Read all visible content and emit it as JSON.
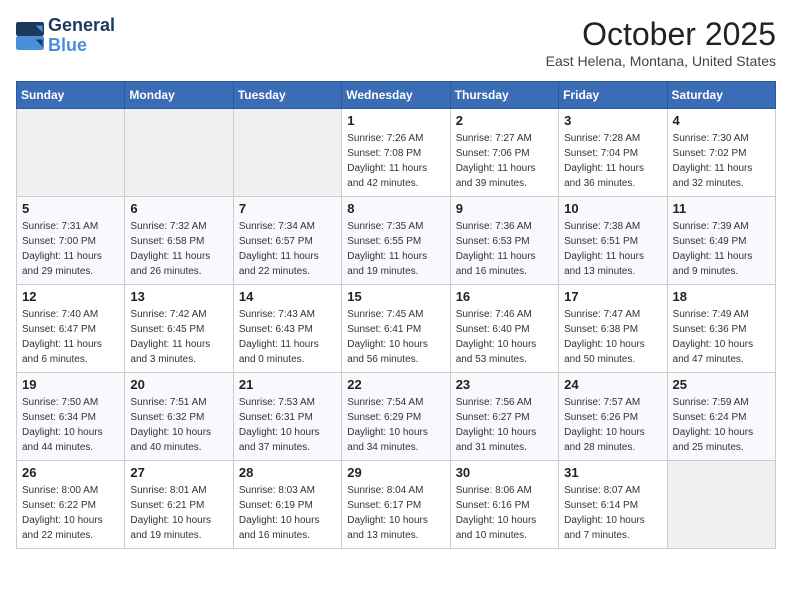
{
  "logo": {
    "line1": "General",
    "line2": "Blue"
  },
  "title": "October 2025",
  "location": "East Helena, Montana, United States",
  "days_of_week": [
    "Sunday",
    "Monday",
    "Tuesday",
    "Wednesday",
    "Thursday",
    "Friday",
    "Saturday"
  ],
  "weeks": [
    [
      {
        "day": "",
        "sunrise": "",
        "sunset": "",
        "daylight": ""
      },
      {
        "day": "",
        "sunrise": "",
        "sunset": "",
        "daylight": ""
      },
      {
        "day": "",
        "sunrise": "",
        "sunset": "",
        "daylight": ""
      },
      {
        "day": "1",
        "sunrise": "Sunrise: 7:26 AM",
        "sunset": "Sunset: 7:08 PM",
        "daylight": "Daylight: 11 hours and 42 minutes."
      },
      {
        "day": "2",
        "sunrise": "Sunrise: 7:27 AM",
        "sunset": "Sunset: 7:06 PM",
        "daylight": "Daylight: 11 hours and 39 minutes."
      },
      {
        "day": "3",
        "sunrise": "Sunrise: 7:28 AM",
        "sunset": "Sunset: 7:04 PM",
        "daylight": "Daylight: 11 hours and 36 minutes."
      },
      {
        "day": "4",
        "sunrise": "Sunrise: 7:30 AM",
        "sunset": "Sunset: 7:02 PM",
        "daylight": "Daylight: 11 hours and 32 minutes."
      }
    ],
    [
      {
        "day": "5",
        "sunrise": "Sunrise: 7:31 AM",
        "sunset": "Sunset: 7:00 PM",
        "daylight": "Daylight: 11 hours and 29 minutes."
      },
      {
        "day": "6",
        "sunrise": "Sunrise: 7:32 AM",
        "sunset": "Sunset: 6:58 PM",
        "daylight": "Daylight: 11 hours and 26 minutes."
      },
      {
        "day": "7",
        "sunrise": "Sunrise: 7:34 AM",
        "sunset": "Sunset: 6:57 PM",
        "daylight": "Daylight: 11 hours and 22 minutes."
      },
      {
        "day": "8",
        "sunrise": "Sunrise: 7:35 AM",
        "sunset": "Sunset: 6:55 PM",
        "daylight": "Daylight: 11 hours and 19 minutes."
      },
      {
        "day": "9",
        "sunrise": "Sunrise: 7:36 AM",
        "sunset": "Sunset: 6:53 PM",
        "daylight": "Daylight: 11 hours and 16 minutes."
      },
      {
        "day": "10",
        "sunrise": "Sunrise: 7:38 AM",
        "sunset": "Sunset: 6:51 PM",
        "daylight": "Daylight: 11 hours and 13 minutes."
      },
      {
        "day": "11",
        "sunrise": "Sunrise: 7:39 AM",
        "sunset": "Sunset: 6:49 PM",
        "daylight": "Daylight: 11 hours and 9 minutes."
      }
    ],
    [
      {
        "day": "12",
        "sunrise": "Sunrise: 7:40 AM",
        "sunset": "Sunset: 6:47 PM",
        "daylight": "Daylight: 11 hours and 6 minutes."
      },
      {
        "day": "13",
        "sunrise": "Sunrise: 7:42 AM",
        "sunset": "Sunset: 6:45 PM",
        "daylight": "Daylight: 11 hours and 3 minutes."
      },
      {
        "day": "14",
        "sunrise": "Sunrise: 7:43 AM",
        "sunset": "Sunset: 6:43 PM",
        "daylight": "Daylight: 11 hours and 0 minutes."
      },
      {
        "day": "15",
        "sunrise": "Sunrise: 7:45 AM",
        "sunset": "Sunset: 6:41 PM",
        "daylight": "Daylight: 10 hours and 56 minutes."
      },
      {
        "day": "16",
        "sunrise": "Sunrise: 7:46 AM",
        "sunset": "Sunset: 6:40 PM",
        "daylight": "Daylight: 10 hours and 53 minutes."
      },
      {
        "day": "17",
        "sunrise": "Sunrise: 7:47 AM",
        "sunset": "Sunset: 6:38 PM",
        "daylight": "Daylight: 10 hours and 50 minutes."
      },
      {
        "day": "18",
        "sunrise": "Sunrise: 7:49 AM",
        "sunset": "Sunset: 6:36 PM",
        "daylight": "Daylight: 10 hours and 47 minutes."
      }
    ],
    [
      {
        "day": "19",
        "sunrise": "Sunrise: 7:50 AM",
        "sunset": "Sunset: 6:34 PM",
        "daylight": "Daylight: 10 hours and 44 minutes."
      },
      {
        "day": "20",
        "sunrise": "Sunrise: 7:51 AM",
        "sunset": "Sunset: 6:32 PM",
        "daylight": "Daylight: 10 hours and 40 minutes."
      },
      {
        "day": "21",
        "sunrise": "Sunrise: 7:53 AM",
        "sunset": "Sunset: 6:31 PM",
        "daylight": "Daylight: 10 hours and 37 minutes."
      },
      {
        "day": "22",
        "sunrise": "Sunrise: 7:54 AM",
        "sunset": "Sunset: 6:29 PM",
        "daylight": "Daylight: 10 hours and 34 minutes."
      },
      {
        "day": "23",
        "sunrise": "Sunrise: 7:56 AM",
        "sunset": "Sunset: 6:27 PM",
        "daylight": "Daylight: 10 hours and 31 minutes."
      },
      {
        "day": "24",
        "sunrise": "Sunrise: 7:57 AM",
        "sunset": "Sunset: 6:26 PM",
        "daylight": "Daylight: 10 hours and 28 minutes."
      },
      {
        "day": "25",
        "sunrise": "Sunrise: 7:59 AM",
        "sunset": "Sunset: 6:24 PM",
        "daylight": "Daylight: 10 hours and 25 minutes."
      }
    ],
    [
      {
        "day": "26",
        "sunrise": "Sunrise: 8:00 AM",
        "sunset": "Sunset: 6:22 PM",
        "daylight": "Daylight: 10 hours and 22 minutes."
      },
      {
        "day": "27",
        "sunrise": "Sunrise: 8:01 AM",
        "sunset": "Sunset: 6:21 PM",
        "daylight": "Daylight: 10 hours and 19 minutes."
      },
      {
        "day": "28",
        "sunrise": "Sunrise: 8:03 AM",
        "sunset": "Sunset: 6:19 PM",
        "daylight": "Daylight: 10 hours and 16 minutes."
      },
      {
        "day": "29",
        "sunrise": "Sunrise: 8:04 AM",
        "sunset": "Sunset: 6:17 PM",
        "daylight": "Daylight: 10 hours and 13 minutes."
      },
      {
        "day": "30",
        "sunrise": "Sunrise: 8:06 AM",
        "sunset": "Sunset: 6:16 PM",
        "daylight": "Daylight: 10 hours and 10 minutes."
      },
      {
        "day": "31",
        "sunrise": "Sunrise: 8:07 AM",
        "sunset": "Sunset: 6:14 PM",
        "daylight": "Daylight: 10 hours and 7 minutes."
      },
      {
        "day": "",
        "sunrise": "",
        "sunset": "",
        "daylight": ""
      }
    ]
  ]
}
